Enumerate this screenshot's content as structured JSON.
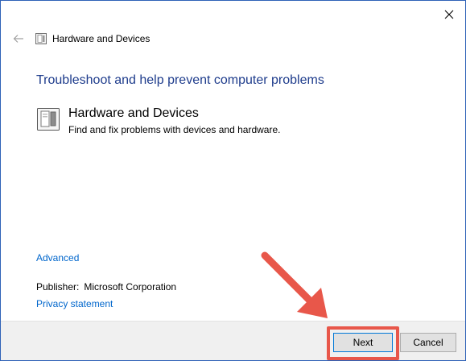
{
  "window": {
    "close_glyph": "✕",
    "back_icon": "back-arrow-icon",
    "title": "Hardware and Devices"
  },
  "main": {
    "heading": "Troubleshoot and help prevent computer problems",
    "item": {
      "icon": "hardware-devices-icon",
      "title": "Hardware and Devices",
      "description": "Find and fix problems with devices and hardware."
    },
    "advanced_link": "Advanced",
    "publisher_label": "Publisher:",
    "publisher_value": "Microsoft Corporation",
    "privacy_link": "Privacy statement"
  },
  "footer": {
    "next_label": "Next",
    "cancel_label": "Cancel"
  },
  "colors": {
    "heading": "#1e3c8c",
    "link": "#0066cc",
    "highlight": "#e8574a",
    "window_border": "#2f62b7"
  }
}
